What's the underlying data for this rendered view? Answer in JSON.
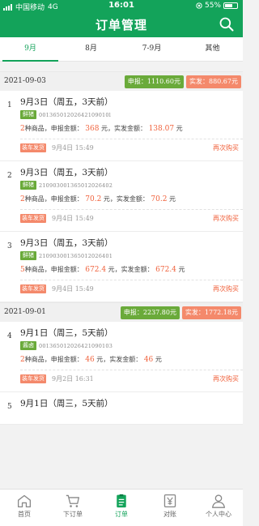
{
  "status_bar": {
    "carrier": "中国移动",
    "network": "4G",
    "time": "16:01",
    "battery": "55%",
    "battery_level": 0.55
  },
  "header": {
    "title": "订单管理",
    "search_icon": "search-icon"
  },
  "tabs": [
    {
      "label": "9月",
      "active": true
    },
    {
      "label": "8月",
      "active": false
    },
    {
      "label": "7-9月",
      "active": false
    },
    {
      "label": "其他",
      "active": false
    }
  ],
  "groups": [
    {
      "date": "2021-09-03",
      "declared": "申报：1110.60元",
      "paid": "实发：880.67元"
    },
    {
      "date": "2021-09-01",
      "declared": "申报：2237.80元",
      "paid": "实发：1772.18元"
    }
  ],
  "orders": [
    {
      "index": "1",
      "title": "9月3日（周五，3天前）",
      "tag": "鲜猪",
      "code": "00136501202642109010l",
      "count": "2",
      "count_suffix": "种商品，申报金额：",
      "declared": "368",
      "mid": "元，实发金额：",
      "paid": "138.07",
      "unit": "元",
      "ship_tag": "装车发货",
      "ship_time": "9月4日 15:49",
      "rebuy": "再次购买"
    },
    {
      "index": "2",
      "title": "9月3日（周五，3天前）",
      "tag": "鲜猪",
      "code": "210903001365012026402",
      "count": "2",
      "count_suffix": "种商品，申报金额：",
      "declared": "70.2",
      "mid": "元，实发金额：",
      "paid": "70.2",
      "unit": "元",
      "ship_tag": "装车发货",
      "ship_time": "9月4日 15:49",
      "rebuy": "再次购买"
    },
    {
      "index": "3",
      "title": "9月3日（周五，3天前）",
      "tag": "鲜猪",
      "code": "210903001365012026401",
      "count": "5",
      "count_suffix": "种商品，申报金额：",
      "declared": "672.4",
      "mid": "元，实发金额：",
      "paid": "672.4",
      "unit": "元",
      "ship_tag": "装车发货",
      "ship_time": "9月4日 15:49",
      "rebuy": "再次购买"
    },
    {
      "index": "4",
      "title": "9月1日（周三，5天前）",
      "tag": "酱卤",
      "code": "001365012026421090103",
      "count": "2",
      "count_suffix": "种商品，申报金额：",
      "declared": "46",
      "mid": "元，实发金额：",
      "paid": "46",
      "unit": "元",
      "ship_tag": "装车发货",
      "ship_time": "9月2日 16:31",
      "rebuy": "再次购买"
    },
    {
      "index": "5",
      "title": "9月1日（周三，5天前）"
    }
  ],
  "tabbar": [
    {
      "label": "首页",
      "icon": "home-icon",
      "active": false
    },
    {
      "label": "下订单",
      "icon": "cart-icon",
      "active": false
    },
    {
      "label": "订单",
      "icon": "order-list-icon",
      "active": true
    },
    {
      "label": "对账",
      "icon": "yen-reconcile-icon",
      "active": false
    },
    {
      "label": "个人中心",
      "icon": "user-icon",
      "active": false
    }
  ],
  "colors": {
    "brand_green": "#13a35a",
    "tag_green": "#6aaa3a",
    "tag_orange": "#f4896b",
    "amount_red": "#f0623c"
  }
}
